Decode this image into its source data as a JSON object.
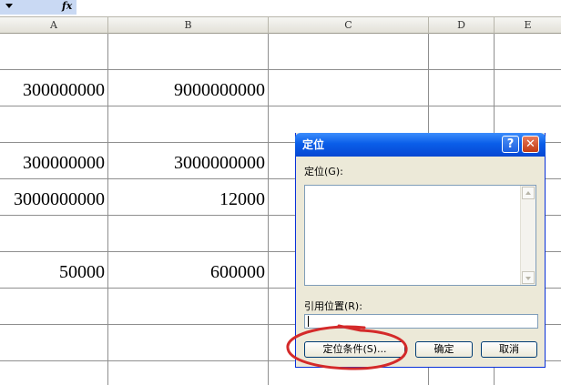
{
  "formula_bar": {
    "fx": "fx"
  },
  "columns": [
    "A",
    "B",
    "C",
    "D",
    "E"
  ],
  "cells": {
    "r2": {
      "A": "300000000",
      "B": "9000000000"
    },
    "r4": {
      "A": "300000000",
      "B": "3000000000"
    },
    "r5": {
      "A": "3000000000",
      "B": "12000"
    },
    "r7": {
      "A": "50000",
      "B": "600000"
    }
  },
  "dialog": {
    "title": "定位",
    "help": "?",
    "close": "✕",
    "goto_label": "定位(G):",
    "reference_label": "引用位置(R):",
    "reference_value": "",
    "buttons": {
      "special": "定位条件(S)...",
      "ok": "确定",
      "cancel": "取消"
    }
  },
  "colors": {
    "annotation": "#d42a2a",
    "titlebar": "#0a5ee9",
    "dialog_bg": "#ece9d8"
  }
}
